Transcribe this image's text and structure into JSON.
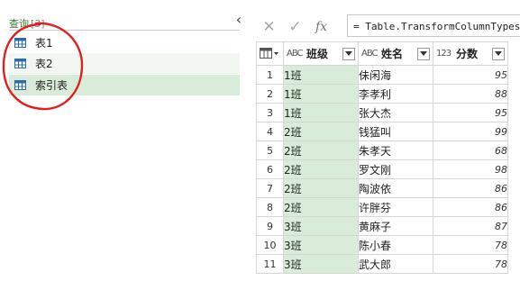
{
  "queries_pane": {
    "header": "查询",
    "count": "[3]",
    "items": [
      {
        "label": "表1",
        "icon": "table-icon"
      },
      {
        "label": "表2",
        "icon": "table-icon"
      },
      {
        "label": "索引表",
        "icon": "table-icon"
      }
    ],
    "collapse_glyph": "‹"
  },
  "toolbar": {
    "cancel_glyph": "✕",
    "confirm_glyph": "✓",
    "fx_glyph": "fx"
  },
  "formula_bar": {
    "text": "= Table.TransformColumnTypes("
  },
  "grid": {
    "columns": [
      {
        "type_icon": "ABC",
        "name": "班级"
      },
      {
        "type_icon": "ABC",
        "name": "姓名"
      },
      {
        "type_icon": "123",
        "name": "分数"
      }
    ],
    "rows": [
      {
        "n": "1",
        "cls": "1班",
        "name": "佅闲海",
        "score": "95"
      },
      {
        "n": "2",
        "cls": "1班",
        "name": "李孝利",
        "score": "88"
      },
      {
        "n": "3",
        "cls": "1班",
        "name": "张大杰",
        "score": "95"
      },
      {
        "n": "4",
        "cls": "2班",
        "name": "钱猛叫",
        "score": "99"
      },
      {
        "n": "5",
        "cls": "2班",
        "name": "朱孝天",
        "score": "68"
      },
      {
        "n": "6",
        "cls": "2班",
        "name": "罗文刚",
        "score": "98"
      },
      {
        "n": "7",
        "cls": "2班",
        "name": "陶波依",
        "score": "86"
      },
      {
        "n": "8",
        "cls": "2班",
        "name": "许胖芬",
        "score": "86"
      },
      {
        "n": "9",
        "cls": "3班",
        "name": "黄麻子",
        "score": "87"
      },
      {
        "n": "10",
        "cls": "3班",
        "name": "陈小春",
        "score": "78"
      },
      {
        "n": "11",
        "cls": "3班",
        "name": "武大郎",
        "score": "78"
      }
    ]
  },
  "colors": {
    "class_column_fill": "#d9ecd9",
    "selected_query_fill": "#d9ecd9",
    "annotation_circle": "#e02020"
  }
}
